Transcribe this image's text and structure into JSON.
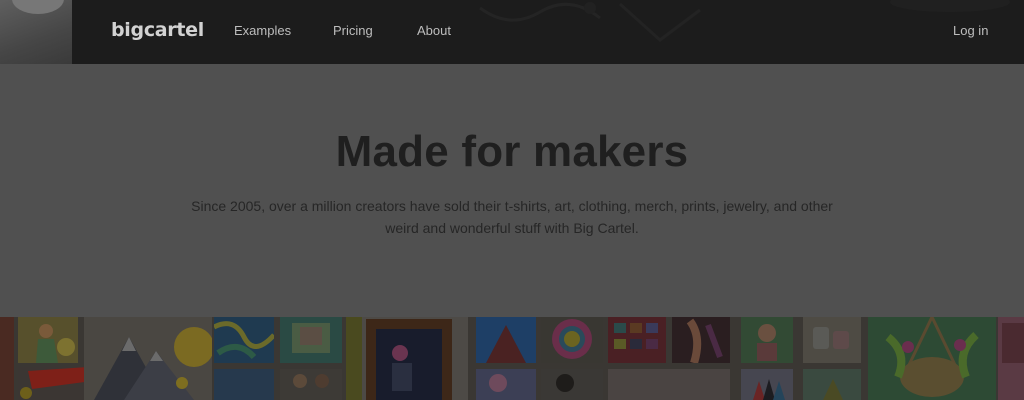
{
  "brand": {
    "name": "bigcartel"
  },
  "nav": {
    "items": [
      {
        "label": "Examples"
      },
      {
        "label": "Pricing"
      },
      {
        "label": "About"
      }
    ],
    "login_label": "Log in"
  },
  "hero": {
    "title": "Made for makers",
    "subtitle": "Since 2005, over a million creators have sold their t-shirts, art, clothing, merch, prints, jewelry, and other weird and wonderful stuff with Big Cartel."
  },
  "collage": {
    "description_tiles": [
      "artwork-tile-figure-yellow",
      "artwork-tile-mountains",
      "artwork-tile-blue-pattern",
      "artwork-tile-teal-print",
      "artwork-tile-framed-art",
      "artwork-tile-blue-poster",
      "artwork-tile-flower-face",
      "artwork-tile-color-grid",
      "artwork-tile-figure-dark",
      "artwork-tile-green-figure",
      "artwork-tile-candles",
      "artwork-tile-hanging-plant",
      "artwork-tile-pink-border"
    ]
  }
}
